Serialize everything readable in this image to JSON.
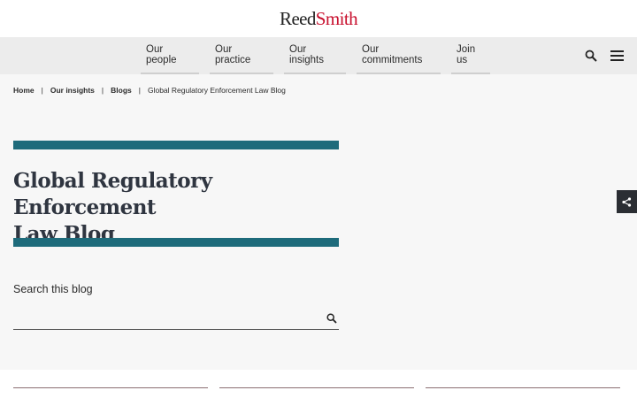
{
  "brand": {
    "part1": "Reed",
    "part2": "Smith"
  },
  "nav": {
    "items": [
      "Our people",
      "Our practice",
      "Our insights",
      "Our commitments",
      "Join us"
    ]
  },
  "breadcrumb": {
    "home": "Home",
    "insights": "Our insights",
    "blogs": "Blogs",
    "current": "Global Regulatory Enforcement Law Blog",
    "separator": "|"
  },
  "hero": {
    "title_line1": "Global Regulatory Enforcement",
    "title_line2": "Law Blog"
  },
  "search": {
    "label": "Search this blog",
    "value": "",
    "placeholder": ""
  },
  "icons": {
    "search": "search-icon",
    "menu": "hamburger-menu-icon",
    "share": "share-icon"
  },
  "colors": {
    "accent_bar": "#1e6b7b",
    "brand_red": "#c8102e",
    "share_bg": "#2b2e33"
  }
}
